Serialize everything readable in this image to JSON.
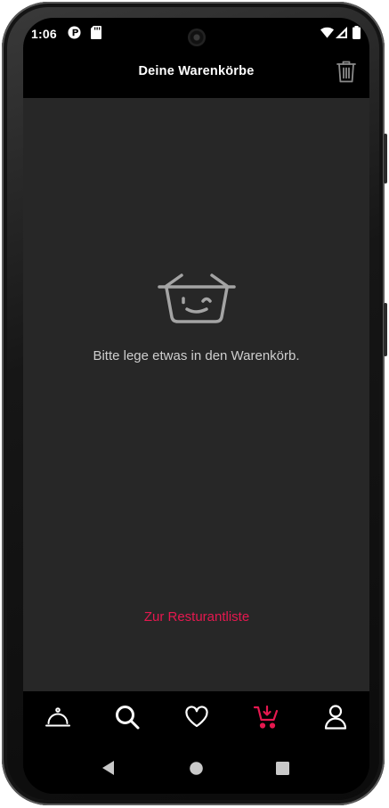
{
  "status_bar": {
    "time": "1:06"
  },
  "app_bar": {
    "title": "Deine Warenkörbe",
    "action_icon": "trash-icon"
  },
  "empty_state": {
    "icon": "winking-basket-icon",
    "message": "Bitte lege etwas in den Warenkörb.",
    "link_label": "Zur Resturantliste"
  },
  "bottom_nav": {
    "items": [
      {
        "id": "restaurants",
        "icon": "cloche-icon",
        "active": false
      },
      {
        "id": "search",
        "icon": "search-icon",
        "active": false
      },
      {
        "id": "favorites",
        "icon": "heart-icon",
        "active": false
      },
      {
        "id": "cart",
        "icon": "cart-icon",
        "active": true
      },
      {
        "id": "profile",
        "icon": "user-icon",
        "active": false
      }
    ]
  },
  "system_nav": {
    "items": [
      "back-icon",
      "home-icon",
      "recents-icon"
    ]
  },
  "colors": {
    "accent": "#e5184f",
    "background": "#272727",
    "bar": "#000000",
    "text_muted": "#cfcfcf"
  }
}
